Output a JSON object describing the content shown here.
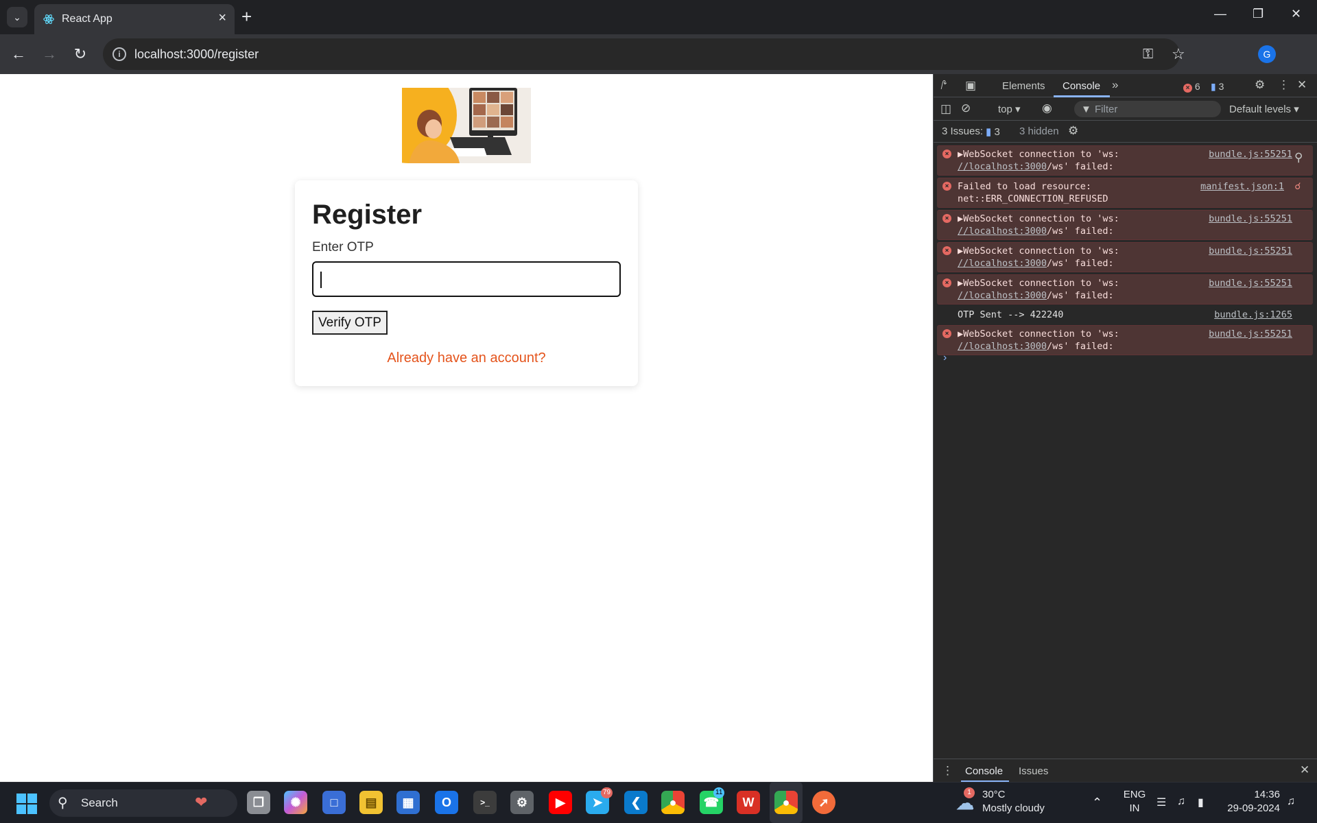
{
  "browser": {
    "tab_title": "React App",
    "url": "localhost:3000/register"
  },
  "page": {
    "heading": "Register",
    "otp_label": "Enter OTP",
    "verify_button": "Verify OTP",
    "login_link": "Already have an account?"
  },
  "devtools": {
    "tabs": [
      "Elements",
      "Console"
    ],
    "error_count": "6",
    "info_count": "3",
    "context": "top",
    "filter_placeholder": "Filter",
    "levels": "Default levels",
    "issues_label": "3 Issues:",
    "issues_count": "3",
    "hidden": "3 hidden",
    "messages": [
      {
        "type": "error",
        "line1": "WebSocket connection to 'ws:",
        "link": "//localhost:3000",
        "rest": "/ws' failed:",
        "source": "bundle.js:55251"
      },
      {
        "type": "error",
        "line1": "Failed to load resource:",
        "line2": "net::ERR_CONNECTION_REFUSED",
        "source": "manifest.json:1"
      },
      {
        "type": "error",
        "line1": "WebSocket connection to 'ws:",
        "link": "//localhost:3000",
        "rest": "/ws' failed:",
        "source": "bundle.js:55251"
      },
      {
        "type": "error",
        "line1": "WebSocket connection to 'ws:",
        "link": "//localhost:3000",
        "rest": "/ws' failed:",
        "source": "bundle.js:55251"
      },
      {
        "type": "error",
        "line1": "WebSocket connection to 'ws:",
        "link": "//localhost:3000",
        "rest": "/ws' failed:",
        "source": "bundle.js:55251"
      },
      {
        "type": "log",
        "line1": "OTP Sent --> 422240",
        "source": "bundle.js:1265"
      },
      {
        "type": "error",
        "line1": "WebSocket connection to 'ws:",
        "link": "//localhost:3000",
        "rest": "/ws' failed:",
        "source": "bundle.js:55251"
      }
    ],
    "drawer_tabs": [
      "Console",
      "Issues"
    ]
  },
  "taskbar": {
    "search": "Search",
    "weather_temp": "30°C",
    "weather_desc": "Mostly cloudy",
    "weather_badge": "1",
    "lang1": "ENG",
    "lang2": "IN",
    "time": "14:36",
    "date": "29-09-2024",
    "telegram_badge": "79",
    "whatsapp_badge": "11"
  }
}
